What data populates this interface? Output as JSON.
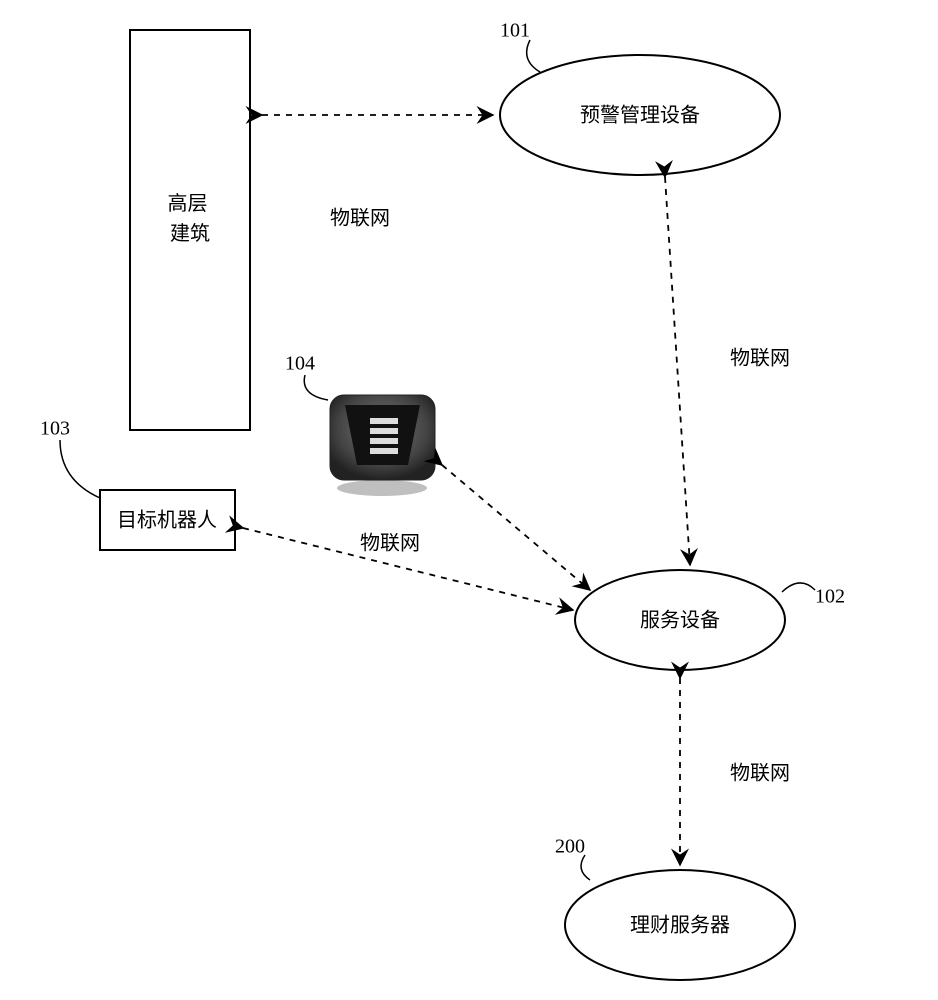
{
  "nodes": {
    "building": {
      "label": "高层建筑",
      "ref": ""
    },
    "warning": {
      "label": "预警管理设备",
      "ref": "101"
    },
    "service": {
      "label": "服务设备",
      "ref": "102"
    },
    "robot": {
      "label": "目标机器人",
      "ref": "103"
    },
    "speaker": {
      "label": "",
      "ref": "104"
    },
    "finance": {
      "label": "理财服务器",
      "ref": "200"
    }
  },
  "edges": {
    "building_warning": {
      "label": "物联网"
    },
    "warning_service": {
      "label": "物联网"
    },
    "robot_service": {
      "label": "物联网"
    },
    "speaker_service": {
      "label": ""
    },
    "service_finance": {
      "label": "物联网"
    }
  }
}
